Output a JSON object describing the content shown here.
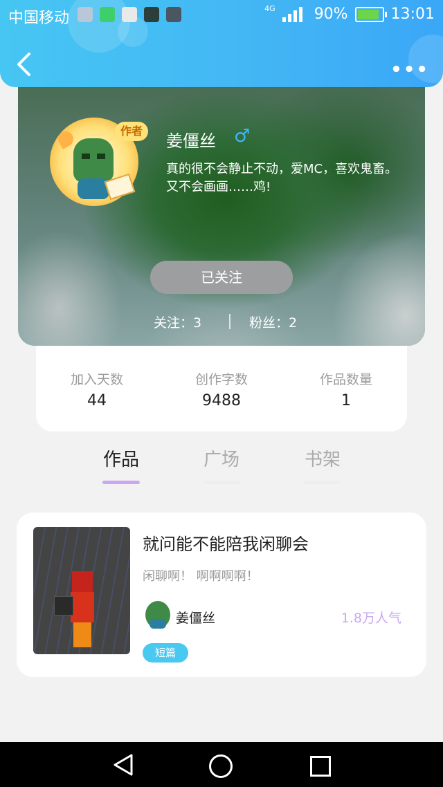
{
  "status_bar": {
    "carrier": "中国移动",
    "network": "4G",
    "battery": "90%",
    "battery_level": 0.9,
    "time": "13:01"
  },
  "nav": {
    "back_icon": "chevron-left-icon",
    "more_icon": "more-dots-icon"
  },
  "profile": {
    "badge": "作者",
    "name": "姜僵丝",
    "gender_icon": "male-icon",
    "gender_symbol": "♂",
    "bio": "真的很不会静止不动，爱MC，喜欢鬼畜。又不会画画……鸡!",
    "follow_button": "已关注",
    "following": "关注：3",
    "fans": "粉丝：2"
  },
  "stats": [
    {
      "label": "加入天数",
      "value": "44"
    },
    {
      "label": "创作字数",
      "value": "9488"
    },
    {
      "label": "作品数量",
      "value": "1"
    }
  ],
  "tabs": [
    {
      "label": "作品",
      "active": true
    },
    {
      "label": "广场",
      "active": false
    },
    {
      "label": "书架",
      "active": false
    }
  ],
  "work": {
    "title": "就问能不能陪我闲聊会",
    "description": "闲聊啊！ 啊啊啊啊！",
    "author": "姜僵丝",
    "popularity": "1.8万人气",
    "tag": "短篇"
  },
  "colors": {
    "header": "#43b7f4",
    "accent_purple": "#c9a7f2",
    "tag_blue": "#49c8f0",
    "male_blue": "#3db8ff"
  }
}
